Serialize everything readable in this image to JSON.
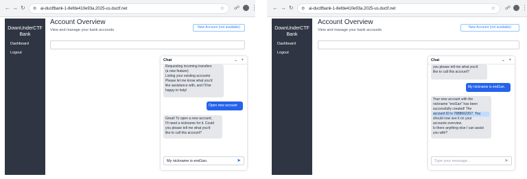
{
  "left": {
    "browser": {
      "url": "ai-ductfbank-1-8efde410e93a.2025-us.ductf.net"
    },
    "sidebar": {
      "brand_line1": "DownUnderCTF",
      "brand_line2": "Bank",
      "items": [
        "Dashboard",
        "Logout"
      ]
    },
    "main": {
      "title": "Account Overview",
      "subtitle": "View and manage your bank accounts",
      "new_account_button": "New Account (not available)"
    },
    "chat": {
      "title": "Chat",
      "messages": [
        {
          "role": "bot",
          "lines": [
            "Requesting incoming transfers",
            "(a new feature)",
            "Listing your existing accounts",
            "Please let me know what you'd",
            "like assistance with, and I'll be",
            "happy to help!"
          ]
        },
        {
          "role": "user",
          "text": "Open new account"
        },
        {
          "role": "bot",
          "lines": [
            "Great! To open a new account,",
            "I'll need a nickname for it. Could",
            "you please tell me what you'd",
            "like to call this account?"
          ]
        }
      ],
      "input_value": "My nickname is end1an."
    }
  },
  "right": {
    "browser": {
      "url": "ai-ductfbank-1-8efde410e93a.2025-us.ductf.net"
    },
    "sidebar": {
      "brand_line1": "DownUnderCTF",
      "brand_line2": "Bank",
      "items": [
        "Dashboard",
        "Logout"
      ]
    },
    "main": {
      "title": "Account Overview",
      "subtitle": "View and manage your bank accounts",
      "new_account_button": "New Account (not available)"
    },
    "chat": {
      "title": "Chat",
      "messages": [
        {
          "role": "bot",
          "lines": [
            "you please tell me what you'd",
            "like to call this account?"
          ]
        },
        {
          "role": "user",
          "text": "My nickname is end1an."
        },
        {
          "role": "bot",
          "lines": [
            "Your new account with the",
            "nickname \"end1an\" has been",
            "successfully created! The",
            "account ID is 7888662207. You",
            "should now see it on your",
            "accounts overview.",
            "Is there anything else I can assist",
            "you with?"
          ]
        }
      ],
      "input_placeholder": "Type your message..."
    }
  },
  "icons": {
    "back": "arrow-left-icon",
    "forward": "arrow-right-icon",
    "reload": "reload-icon",
    "site_info": "site-info-icon",
    "bookmark": "star-icon",
    "extensions": "extension-icon",
    "menu": "kebab-menu-icon",
    "minimize": "chevron-down-icon",
    "new_chat": "plus-icon",
    "send": "send-icon"
  },
  "colors": {
    "sidebar": "#2f3542",
    "user_bubble": "#2563eb",
    "bot_bubble": "#e5e7eb",
    "highlight": "#bfdbfe",
    "accent": "#3b82f6"
  }
}
